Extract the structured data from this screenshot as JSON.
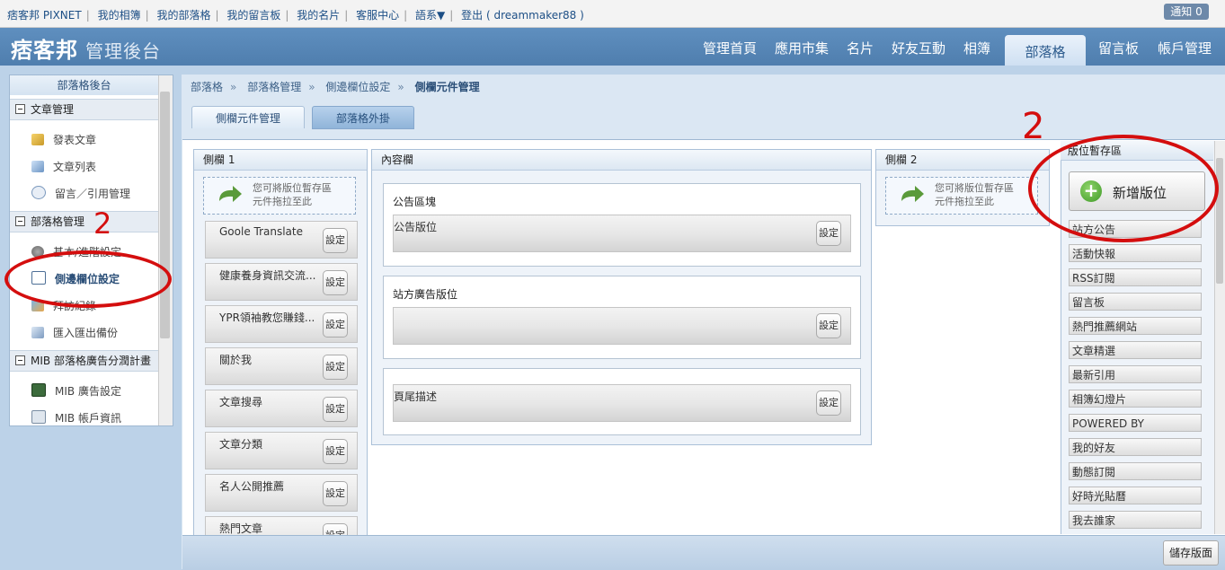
{
  "topbar": {
    "links": [
      "痞客邦 PIXNET",
      "我的相簿",
      "我的部落格",
      "我的留言板",
      "我的名片",
      "客服中心",
      "語系▼",
      "登出 ( dreammaker88 )"
    ],
    "notice": "通知 0"
  },
  "header": {
    "logo": "痞客邦",
    "subtitle": "管理後台",
    "nav": [
      "管理首頁",
      "應用市集",
      "名片",
      "好友互動",
      "相簿",
      "部落格",
      "留言板",
      "帳戶管理"
    ],
    "active_nav": "部落格"
  },
  "sidebar": {
    "title": "部落格後台",
    "sections": [
      {
        "label": "文章管理",
        "items": [
          "發表文章",
          "文章列表",
          "留言／引用管理"
        ]
      },
      {
        "label": "部落格管理",
        "items": [
          "基本/進階設定",
          "側邊欄位設定",
          "拜訪紀錄",
          "匯入匯出備份"
        ]
      },
      {
        "label": "MIB 部落格廣告分潤計畫",
        "items": [
          "MIB 廣告設定",
          "MIB 帳戶資訊"
        ]
      }
    ]
  },
  "breadcrumb": {
    "items": [
      "部落格",
      "部落格管理",
      "側邊欄位設定"
    ],
    "separator": "»",
    "current": "側欄元件管理"
  },
  "tabs": [
    "側欄元件管理",
    "部落格外掛"
  ],
  "columns": {
    "sidebar1": {
      "title": "側欄 1",
      "drop_hint": [
        "您可將版位暫存區",
        "元件拖拉至此"
      ],
      "widgets": [
        "Goole Translate",
        "健康養身資訊交流...",
        "YPR領袖教您賺錢...",
        "關於我",
        "文章搜尋",
        "文章分類",
        "名人公開推薦",
        "熱門文章"
      ]
    },
    "content": {
      "title": "內容欄",
      "boxes": [
        {
          "title": "公告區塊",
          "slot": "公告版位"
        },
        {
          "title": "站方廣告版位",
          "slot": ""
        },
        {
          "title": "",
          "slot": "頁尾描述"
        }
      ]
    },
    "sidebar2": {
      "title": "側欄 2",
      "drop_hint": [
        "您可將版位暫存區",
        "元件拖拉至此"
      ]
    }
  },
  "setting_label": "設定",
  "storage": {
    "title": "版位暫存區",
    "add_button": "新增版位",
    "items": [
      "站方公告",
      "活動快報",
      "RSS訂閱",
      "留言板",
      "熱門推薦網站",
      "文章精選",
      "最新引用",
      "相簿幻燈片",
      "POWERED BY",
      "我的好友",
      "動態訂閱",
      "好時光貼曆",
      "我去誰家"
    ]
  },
  "save_button": "儲存版面",
  "annotations": {
    "number_1": "2",
    "number_2": "2",
    "color": "#d40e0e"
  }
}
